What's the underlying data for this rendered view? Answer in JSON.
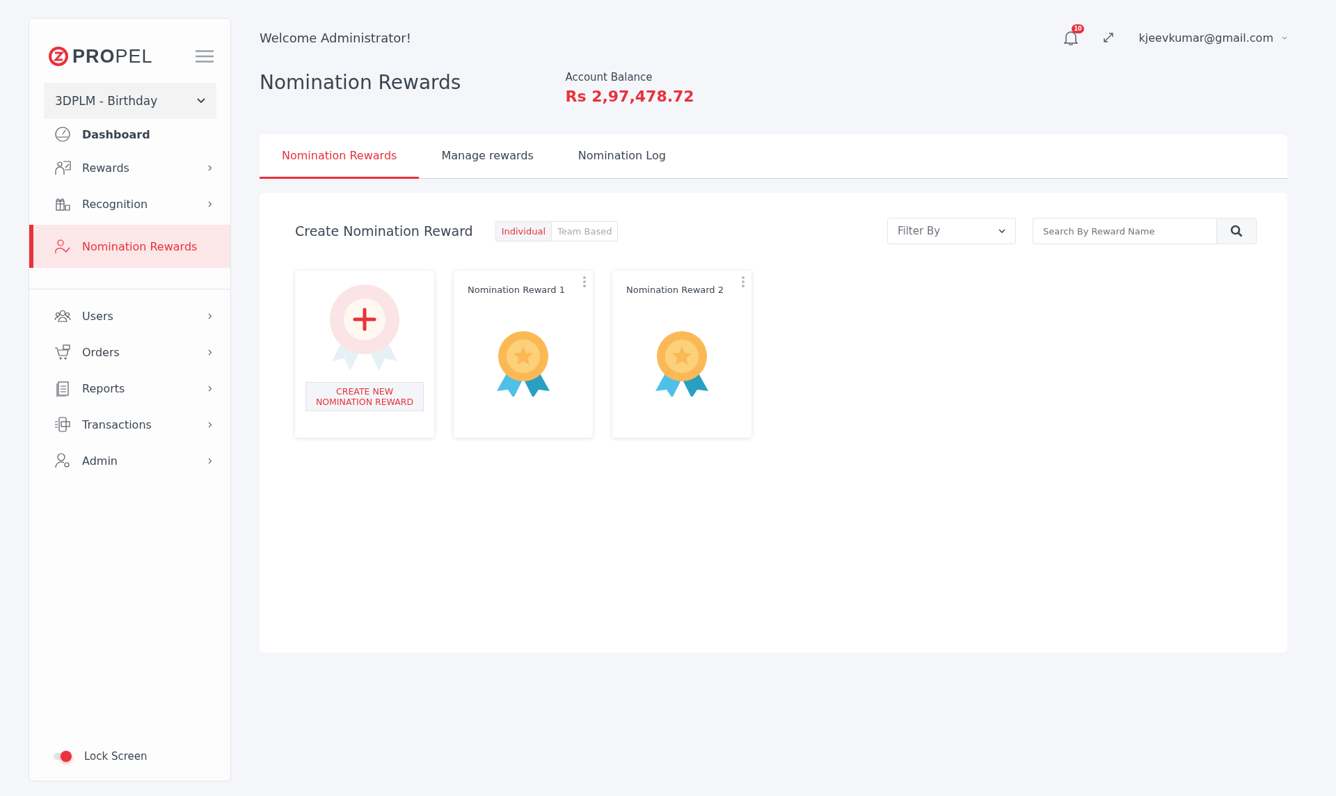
{
  "sidebar": {
    "logo": "**PRO**PEL",
    "program_select": "3DPLM - Birthday",
    "menu": [
      {
        "label": "Dashboard",
        "kind": "link",
        "selected": false
      },
      {
        "label": "Rewards",
        "kind": "group",
        "selected": false
      },
      {
        "label": "Recognition",
        "kind": "group",
        "selected": false
      },
      {
        "label": "Nomination Rewards",
        "kind": "link",
        "selected": true
      }
    ],
    "menu_secondary": [
      {
        "label": "Users",
        "kind": "group",
        "selected": false
      },
      {
        "label": "Orders",
        "kind": "group",
        "selected": false
      },
      {
        "label": "Reports",
        "kind": "group",
        "selected": false
      },
      {
        "label": "Transactions",
        "kind": "group",
        "selected": false
      },
      {
        "label": "Admin",
        "kind": "group",
        "selected": false
      }
    ],
    "lock_screen": {
      "label": "Lock Screen",
      "on": true
    }
  },
  "header": {
    "welcome": "Welcome Administrator!",
    "notification_count": "10",
    "user_email": "kjeevkumar@gmail.com"
  },
  "page": {
    "title": "Nomination Rewards",
    "balance_label": "Account Balance",
    "balance_value": "Rs 2,97,478.72"
  },
  "tabs": [
    {
      "label": "Nomination Rewards",
      "selected": true
    },
    {
      "label": "Manage rewards",
      "selected": false
    },
    {
      "label": "Nomination Log",
      "selected": false
    }
  ],
  "panel": {
    "title": "Create Nomination Reward",
    "type_toggle": [
      {
        "label": "Individual",
        "selected": true
      },
      {
        "label": "Team Based",
        "selected": false
      }
    ],
    "filter": {
      "placeholder": "Filter By"
    },
    "search": {
      "placeholder": "Search By Reward Name"
    },
    "cards": [
      {
        "kind": "create",
        "button": "CREATE NEW NOMINATION REWARD"
      },
      {
        "kind": "reward",
        "title": "Nomination Reward 1"
      },
      {
        "kind": "reward",
        "title": "Nomination Reward 2"
      }
    ]
  }
}
